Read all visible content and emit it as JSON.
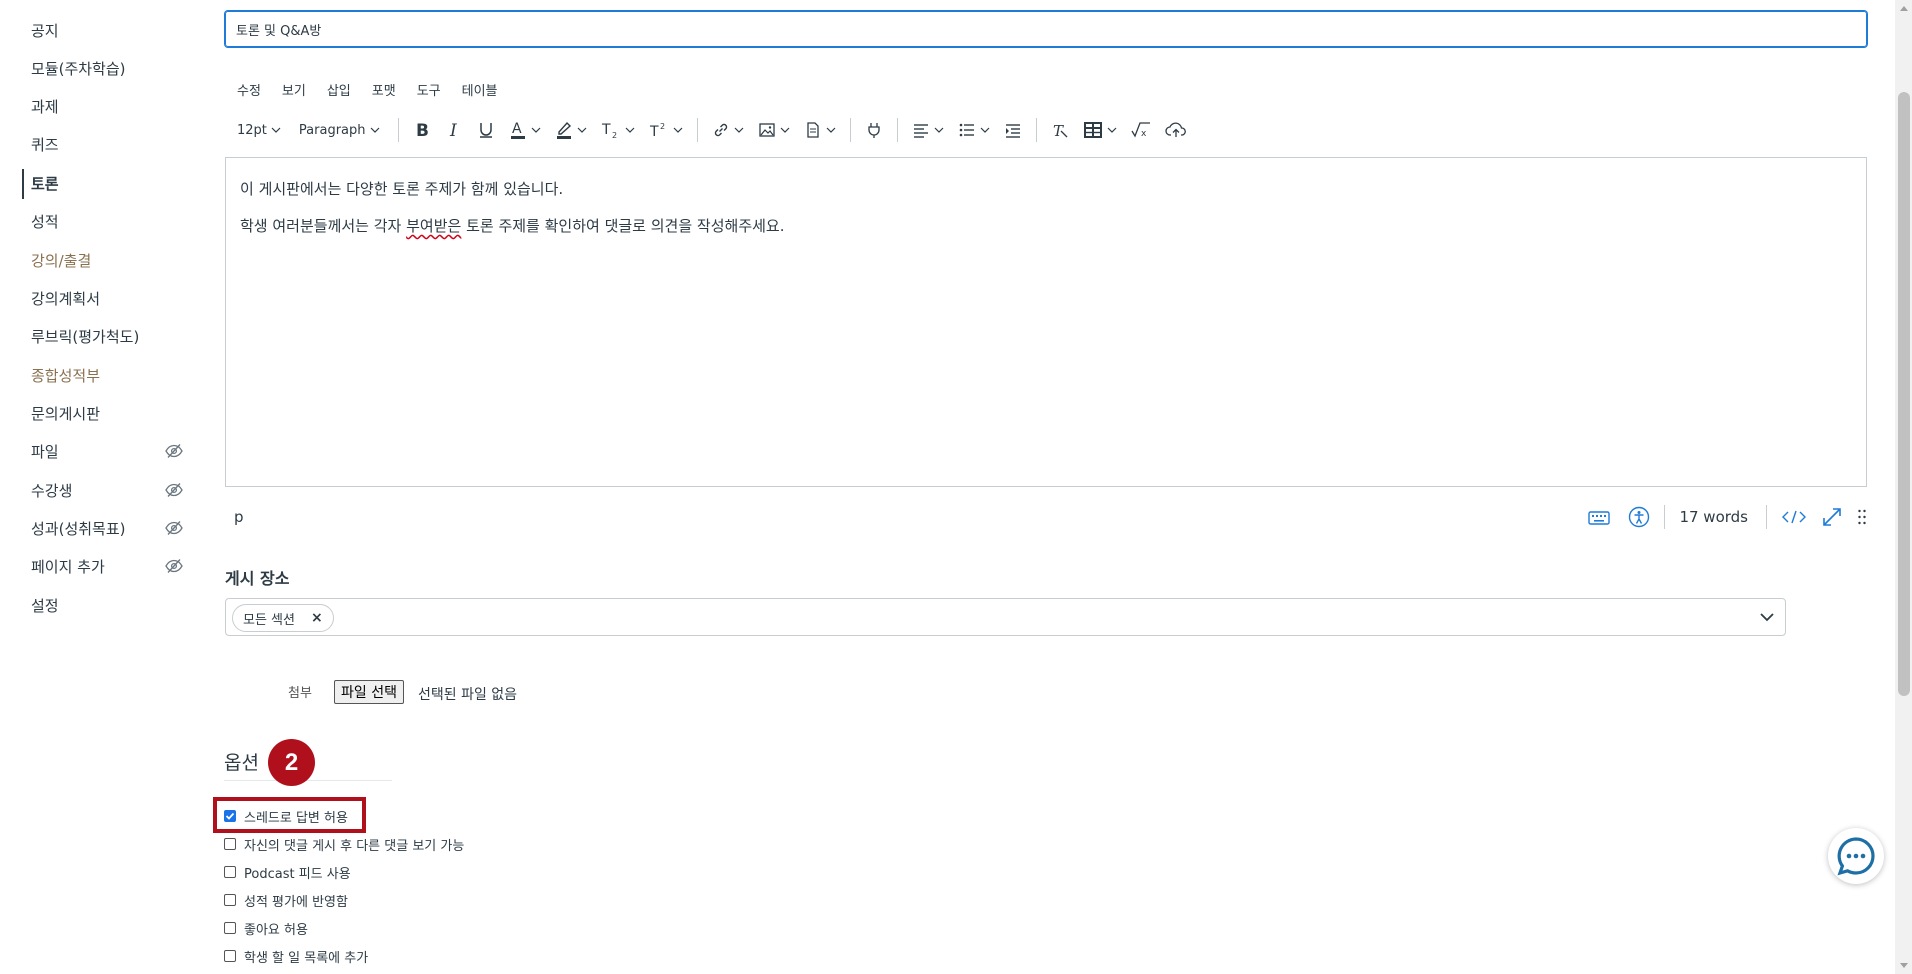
{
  "sidebar": {
    "items": [
      {
        "label": "공지",
        "state": "normal",
        "hidden": false
      },
      {
        "label": "모듈(주차학습)",
        "state": "normal",
        "hidden": false
      },
      {
        "label": "과제",
        "state": "normal",
        "hidden": false
      },
      {
        "label": "퀴즈",
        "state": "normal",
        "hidden": false
      },
      {
        "label": "토론",
        "state": "active",
        "hidden": false
      },
      {
        "label": "성적",
        "state": "normal",
        "hidden": false
      },
      {
        "label": "강의/출결",
        "state": "faded",
        "hidden": false
      },
      {
        "label": "강의계획서",
        "state": "normal",
        "hidden": false
      },
      {
        "label": "루브릭(평가척도)",
        "state": "normal",
        "hidden": false
      },
      {
        "label": "종합성적부",
        "state": "faded",
        "hidden": false
      },
      {
        "label": "문의게시판",
        "state": "normal",
        "hidden": false
      },
      {
        "label": "파일",
        "state": "normal",
        "hidden": true
      },
      {
        "label": "수강생",
        "state": "normal",
        "hidden": true
      },
      {
        "label": "성과(성취목표)",
        "state": "normal",
        "hidden": true
      },
      {
        "label": "페이지 추가",
        "state": "normal",
        "hidden": true
      },
      {
        "label": "설정",
        "state": "normal",
        "hidden": false
      }
    ]
  },
  "title_field": {
    "value": "토론 및 Q&A방"
  },
  "editor": {
    "menus": [
      "수정",
      "보기",
      "삽입",
      "포맷",
      "도구",
      "테이블"
    ],
    "font_size": "12pt",
    "block_format": "Paragraph",
    "content": {
      "line1": "이 게시판에서는 다양한 토론 주제가 함께 있습니다.",
      "line2_before": "학생 여러분들께서는 각자 ",
      "line2_misspelled": "부여받은",
      "line2_after": " 토론 주제를 확인하여 댓글로 의견을 작성해주세요."
    },
    "path": "p",
    "word_count": "17 words"
  },
  "post_to": {
    "label": "게시 장소",
    "chip": "모든 섹션"
  },
  "attachment": {
    "label": "첨부",
    "button": "파일 선택",
    "status": "선택된 파일 없음"
  },
  "options": {
    "title": "옵션",
    "badge": "2",
    "items": [
      {
        "label": "스레드로 답변 허용",
        "checked": true
      },
      {
        "label": "자신의 댓글 게시 후 다른 댓글 보기 가능",
        "checked": false
      },
      {
        "label": "Podcast 피드 사용",
        "checked": false
      },
      {
        "label": "성적 평가에 반영함",
        "checked": false
      },
      {
        "label": "좋아요 허용",
        "checked": false
      },
      {
        "label": "학생 할 일 목록에 추가",
        "checked": false
      }
    ]
  },
  "colors": {
    "accent_blue": "#1f7bd8",
    "highlight_red": "#b0101c",
    "text": "#2d3b45"
  }
}
